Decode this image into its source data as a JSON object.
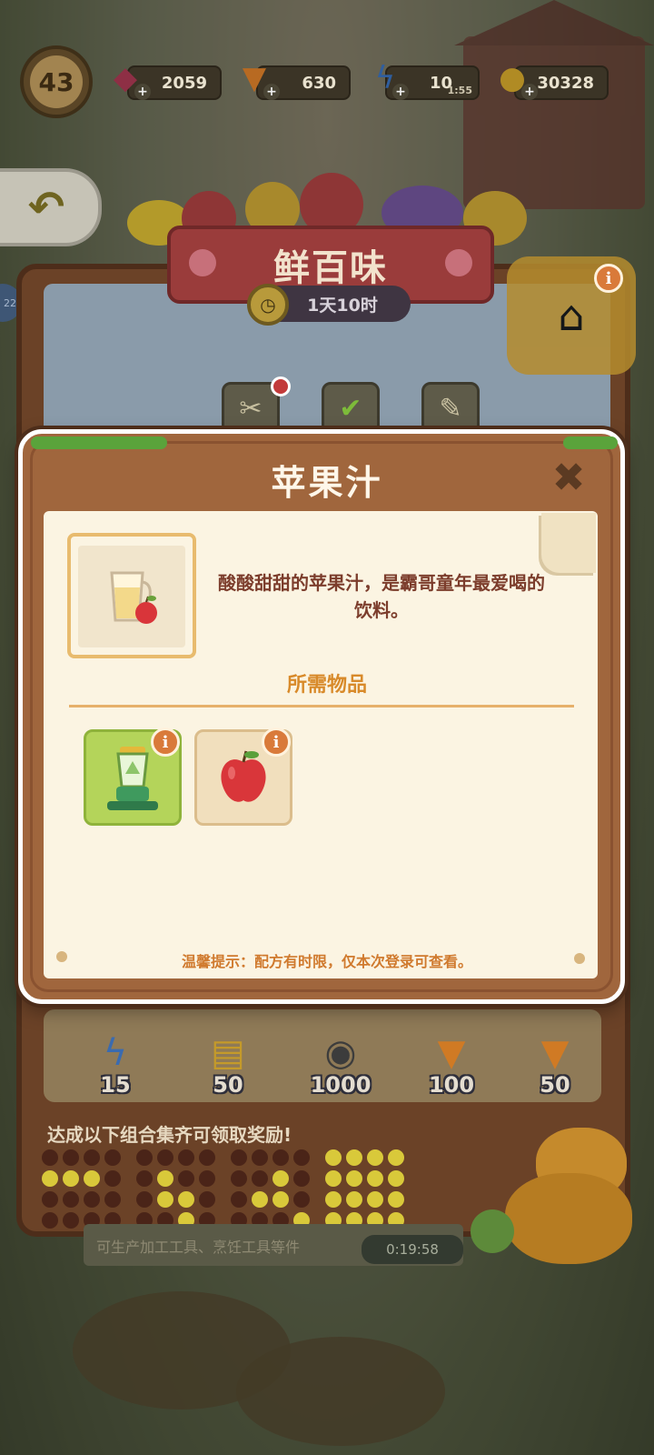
{
  "hud": {
    "level": "43",
    "gems": "2059",
    "carrots": "630",
    "energy": "10",
    "energy_timer": "1:55",
    "coins": "30328",
    "plus": "+"
  },
  "side": {
    "back_icon": "↶",
    "side_tab_number": "22"
  },
  "event": {
    "title": "鲜百味",
    "timer": "1天10时",
    "info": "i",
    "rewards": [
      {
        "icon": "lightning-icon",
        "amount": "15"
      },
      {
        "icon": "coupon-icon",
        "amount": "50"
      },
      {
        "icon": "seed-icon",
        "amount": "1000"
      },
      {
        "icon": "carrot-icon",
        "amount": "100"
      },
      {
        "icon": "carrot-icon",
        "amount": "50"
      }
    ],
    "combo_text": "达成以下组合集齐可领取奖励!",
    "bottom_strip_text": "可生产加工工具、烹饪工具等件",
    "bottom_timer": "0:19:58"
  },
  "modal": {
    "title": "苹果汁",
    "close_icon": "✖",
    "description": "酸酸甜甜的苹果汁，是霸哥童年最爱喝的饮料。",
    "required_title": "所需物品",
    "required_items": [
      {
        "name": "juicer",
        "icon": "juicer-icon",
        "info": "i"
      },
      {
        "name": "apple",
        "icon": "apple-icon",
        "info": "i"
      }
    ],
    "tip": "温馨提示：配方有时限，仅本次登录可查看。"
  },
  "colors": {
    "modal_bg": "#a0663d",
    "paper": "#fbf4e2",
    "accent_orange": "#d88a2a",
    "title_text": "#fff7ea",
    "desc_text": "#7c3d2c",
    "slot_green": "#b4d45a"
  }
}
